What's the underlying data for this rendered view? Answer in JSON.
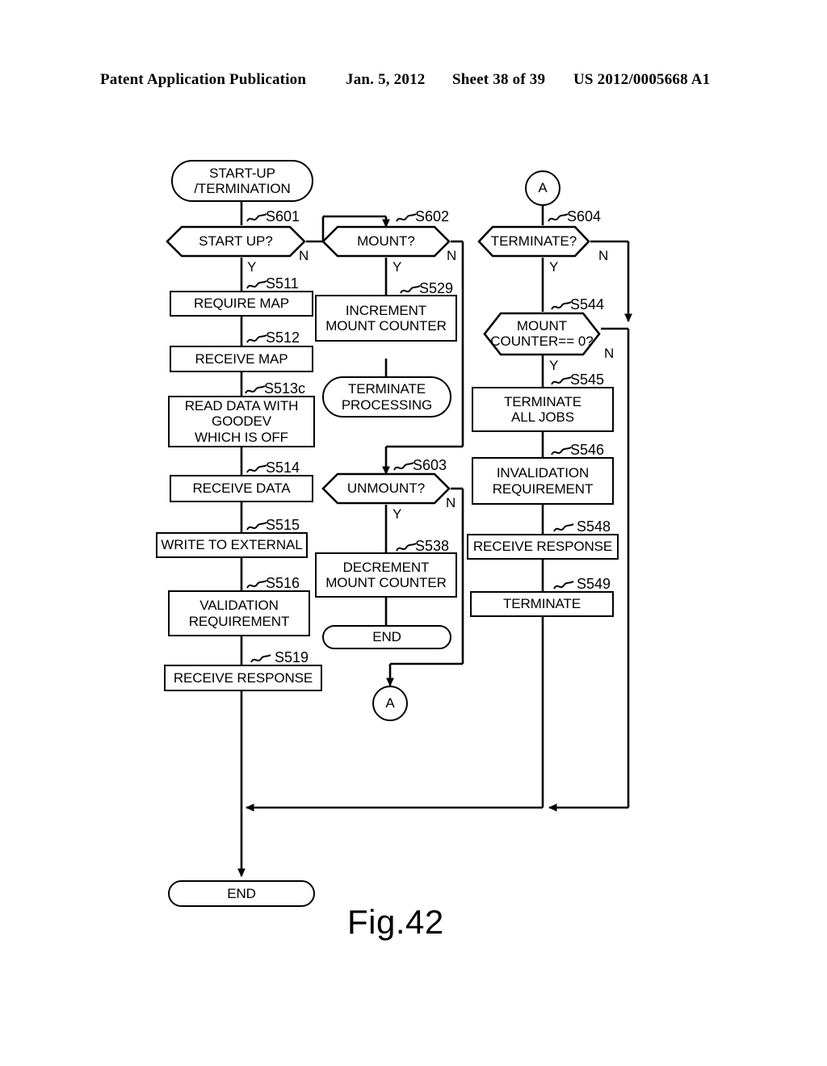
{
  "header": {
    "publication": "Patent Application Publication",
    "date": "Jan. 5, 2012",
    "sheet": "Sheet 38 of 39",
    "number": "US 2012/0005668 A1"
  },
  "figure": {
    "caption": "Fig.42"
  },
  "nodes": {
    "start_terminal": "START-UP\n/TERMINATION",
    "start_up_decision": "START UP?",
    "require_map": "REQUIRE MAP",
    "receive_map": "RECEIVE MAP",
    "read_data": "READ DATA WITH\nGOODEV\nWHICH IS OFF",
    "receive_data": "RECEIVE DATA",
    "write_external": "WRITE TO EXTERNAL",
    "validation_requirement": "VALIDATION\nREQUIREMENT",
    "receive_response_left": "RECEIVE RESPONSE",
    "end_left": "END",
    "mount_decision": "MOUNT?",
    "increment_counter": "INCREMENT\nMOUNT COUNTER",
    "terminate_processing": "TERMINATE\nPROCESSING",
    "unmount_decision": "UNMOUNT?",
    "decrement_counter": "DECREMENT\nMOUNT COUNTER",
    "end_middle": "END",
    "connector_a_bottom": "A",
    "connector_a_top": "A",
    "terminate_decision": "TERMINATE?",
    "mount_counter_zero": "MOUNT\nCOUNTER== 0?",
    "terminate_all_jobs": "TERMINATE\nALL JOBS",
    "invalidation_requirement": "INVALIDATION\nREQUIREMENT",
    "receive_response_right": "RECEIVE RESPONSE",
    "terminate_right": "TERMINATE"
  },
  "steprefs": {
    "s601": "S601",
    "s511": "S511",
    "s512": "S512",
    "s513c": "S513c",
    "s514": "S514",
    "s515": "S515",
    "s516": "S516",
    "s519": "S519",
    "s602": "S602",
    "s529": "S529",
    "s603": "S603",
    "s538": "S538",
    "s604": "S604",
    "s544": "S544",
    "s545": "S545",
    "s546": "S546",
    "s548": "S548",
    "s549": "S549"
  },
  "branches": {
    "startup_yes": "Y",
    "startup_no": "N",
    "mount_yes": "Y",
    "mount_no": "N",
    "unmount_yes": "Y",
    "unmount_no": "N",
    "terminate_yes": "Y",
    "terminate_no": "N",
    "counter_yes": "Y",
    "counter_no": "N"
  },
  "colors": {
    "ink": "#000000",
    "paper": "#ffffff"
  }
}
